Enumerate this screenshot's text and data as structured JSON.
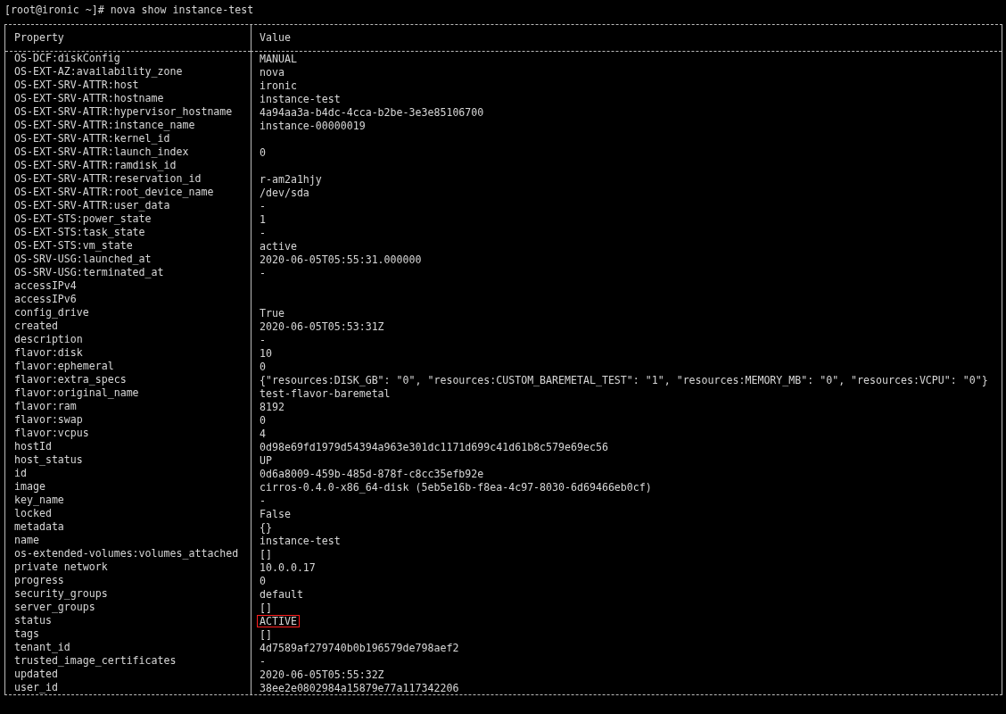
{
  "prompt": "[root@ironic ~]# nova show instance-test",
  "table": {
    "columns": [
      "Property",
      "Value"
    ],
    "rows": [
      {
        "property": "OS-DCF:diskConfig",
        "value": "MANUAL"
      },
      {
        "property": "OS-EXT-AZ:availability_zone",
        "value": "nova"
      },
      {
        "property": "OS-EXT-SRV-ATTR:host",
        "value": "ironic"
      },
      {
        "property": "OS-EXT-SRV-ATTR:hostname",
        "value": "instance-test"
      },
      {
        "property": "OS-EXT-SRV-ATTR:hypervisor_hostname",
        "value": "4a94aa3a-b4dc-4cca-b2be-3e3e85106700"
      },
      {
        "property": "OS-EXT-SRV-ATTR:instance_name",
        "value": "instance-00000019"
      },
      {
        "property": "OS-EXT-SRV-ATTR:kernel_id"
      },
      {
        "property": "OS-EXT-SRV-ATTR:launch_index",
        "value": "0"
      },
      {
        "property": "OS-EXT-SRV-ATTR:ramdisk_id"
      },
      {
        "property": "OS-EXT-SRV-ATTR:reservation_id",
        "value": "r-am2a1hjy"
      },
      {
        "property": "OS-EXT-SRV-ATTR:root_device_name",
        "value": "/dev/sda"
      },
      {
        "property": "OS-EXT-SRV-ATTR:user_data",
        "value": "-"
      },
      {
        "property": "OS-EXT-STS:power_state",
        "value": "1"
      },
      {
        "property": "OS-EXT-STS:task_state",
        "value": "-"
      },
      {
        "property": "OS-EXT-STS:vm_state",
        "value": "active"
      },
      {
        "property": "OS-SRV-USG:launched_at",
        "value": "2020-06-05T05:55:31.000000"
      },
      {
        "property": "OS-SRV-USG:terminated_at",
        "value": "-"
      },
      {
        "property": "accessIPv4"
      },
      {
        "property": "accessIPv6"
      },
      {
        "property": "config_drive",
        "value": "True"
      },
      {
        "property": "created",
        "value": "2020-06-05T05:53:31Z"
      },
      {
        "property": "description",
        "value": "-"
      },
      {
        "property": "flavor:disk",
        "value": "10"
      },
      {
        "property": "flavor:ephemeral",
        "value": "0"
      },
      {
        "property": "flavor:extra_specs",
        "value": "{\"resources:DISK_GB\": \"0\", \"resources:CUSTOM_BAREMETAL_TEST\": \"1\", \"resources:MEMORY_MB\": \"0\", \"resources:VCPU\": \"0\"}"
      },
      {
        "property": "flavor:original_name",
        "value": "test-flavor-baremetal"
      },
      {
        "property": "flavor:ram",
        "value": "8192"
      },
      {
        "property": "flavor:swap",
        "value": "0"
      },
      {
        "property": "flavor:vcpus",
        "value": "4"
      },
      {
        "property": "hostId",
        "value": "0d98e69fd1979d54394a963e301dc1171d699c41d61b8c579e69ec56"
      },
      {
        "property": "host_status",
        "value": "UP"
      },
      {
        "property": "id",
        "value": "0d6a8009-459b-485d-878f-c8cc35efb92e"
      },
      {
        "property": "image",
        "value": "cirros-0.4.0-x86_64-disk (5eb5e16b-f8ea-4c97-8030-6d69466eb0cf)"
      },
      {
        "property": "key_name",
        "value": "-"
      },
      {
        "property": "locked",
        "value": "False"
      },
      {
        "property": "metadata",
        "value": "{}"
      },
      {
        "property": "name",
        "value": "instance-test"
      },
      {
        "property": "os-extended-volumes:volumes_attached",
        "value": "[]"
      },
      {
        "property": "private network",
        "value": "10.0.0.17"
      },
      {
        "property": "progress",
        "value": "0"
      },
      {
        "property": "security_groups",
        "value": "default"
      },
      {
        "property": "server_groups",
        "value": "[]"
      },
      {
        "property": "status",
        "value": "ACTIVE",
        "highlighted": true
      },
      {
        "property": "tags",
        "value": "[]"
      },
      {
        "property": "tenant_id",
        "value": "4d7589af279740b0b196579de798aef2"
      },
      {
        "property": "trusted_image_certificates",
        "value": "-"
      },
      {
        "property": "updated",
        "value": "2020-06-05T05:55:32Z"
      },
      {
        "property": "user_id",
        "value": "38ee2e0802984a15879e77a117342206"
      }
    ]
  }
}
